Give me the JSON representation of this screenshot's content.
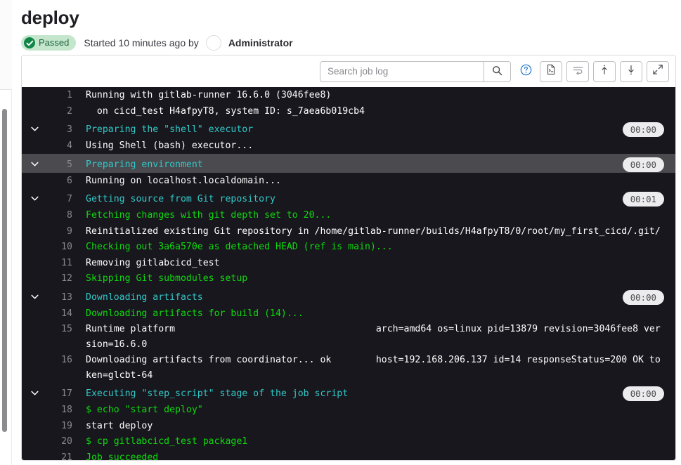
{
  "header": {
    "title": "deploy",
    "status_label": "Passed",
    "status_color": "#108548",
    "status_bg": "#c3e6cd",
    "started_text": "Started 10 minutes ago by",
    "author": "Administrator"
  },
  "toolbar": {
    "search_placeholder": "Search job log",
    "search_value": "",
    "search_button_label": "search-icon",
    "help_label": "help-icon",
    "raw_label": "show-raw-icon",
    "wrap_label": "toggle-soft-wrap-icon",
    "scroll_top_label": "scroll-to-top-icon",
    "scroll_bottom_label": "scroll-to-bottom-icon",
    "fullscreen_label": "fullscreen-icon"
  },
  "log": {
    "lines": [
      {
        "n": "1",
        "text": "Running with gitlab-runner 16.6.0 (3046fee8)",
        "color": "white",
        "section": false,
        "collapsible": false,
        "duration": "",
        "highlight": false
      },
      {
        "n": "2",
        "text": "  on cicd_test H4afpyT8, system ID: s_7aea6b019cb4",
        "color": "white",
        "section": false,
        "collapsible": false,
        "duration": "",
        "highlight": false
      },
      {
        "n": "3",
        "text": "Preparing the \"shell\" executor",
        "color": "cyan",
        "section": true,
        "collapsible": true,
        "duration": "00:00",
        "highlight": false
      },
      {
        "n": "4",
        "text": "Using Shell (bash) executor...",
        "color": "white",
        "section": false,
        "collapsible": false,
        "duration": "",
        "highlight": false
      },
      {
        "n": "5",
        "text": "Preparing environment",
        "color": "cyan",
        "section": true,
        "collapsible": true,
        "duration": "00:00",
        "highlight": true
      },
      {
        "n": "6",
        "text": "Running on localhost.localdomain...",
        "color": "white",
        "section": false,
        "collapsible": false,
        "duration": "",
        "highlight": false
      },
      {
        "n": "7",
        "text": "Getting source from Git repository",
        "color": "cyan",
        "section": true,
        "collapsible": true,
        "duration": "00:01",
        "highlight": false
      },
      {
        "n": "8",
        "text": "Fetching changes with git depth set to 20...",
        "color": "green",
        "section": false,
        "collapsible": false,
        "duration": "",
        "highlight": false
      },
      {
        "n": "9",
        "text": "Reinitialized existing Git repository in /home/gitlab-runner/builds/H4afpyT8/0/root/my_first_cicd/.git/",
        "color": "white",
        "section": false,
        "collapsible": false,
        "duration": "",
        "highlight": false
      },
      {
        "n": "10",
        "text": "Checking out 3a6a570e as detached HEAD (ref is main)...",
        "color": "green",
        "section": false,
        "collapsible": false,
        "duration": "",
        "highlight": false
      },
      {
        "n": "11",
        "text": "Removing gitlabcicd_test",
        "color": "white",
        "section": false,
        "collapsible": false,
        "duration": "",
        "highlight": false
      },
      {
        "n": "12",
        "text": "Skipping Git submodules setup",
        "color": "green",
        "section": false,
        "collapsible": false,
        "duration": "",
        "highlight": false
      },
      {
        "n": "13",
        "text": "Downloading artifacts",
        "color": "cyan",
        "section": true,
        "collapsible": true,
        "duration": "00:00",
        "highlight": false
      },
      {
        "n": "14",
        "text": "Downloading artifacts for build (14)...",
        "color": "green",
        "section": false,
        "collapsible": false,
        "duration": "",
        "highlight": false
      },
      {
        "n": "15",
        "text": "Runtime platform                                    arch=amd64 os=linux pid=13879 revision=3046fee8 version=16.6.0",
        "color": "white",
        "section": false,
        "collapsible": false,
        "duration": "",
        "highlight": false
      },
      {
        "n": "16",
        "text": "Downloading artifacts from coordinator... ok        host=192.168.206.137 id=14 responseStatus=200 OK token=glcbt-64",
        "color": "white",
        "section": false,
        "collapsible": false,
        "duration": "",
        "highlight": false
      },
      {
        "n": "17",
        "text": "Executing \"step_script\" stage of the job script",
        "color": "cyan",
        "section": true,
        "collapsible": true,
        "duration": "00:00",
        "highlight": false
      },
      {
        "n": "18",
        "text": "$ echo \"start deploy\"",
        "color": "green",
        "section": false,
        "collapsible": false,
        "duration": "",
        "highlight": false
      },
      {
        "n": "19",
        "text": "start deploy",
        "color": "white",
        "section": false,
        "collapsible": false,
        "duration": "",
        "highlight": false
      },
      {
        "n": "20",
        "text": "$ cp gitlabcicd_test package1",
        "color": "green",
        "section": false,
        "collapsible": false,
        "duration": "",
        "highlight": false
      },
      {
        "n": "21",
        "text": "Job succeeded",
        "color": "green",
        "section": false,
        "collapsible": false,
        "duration": "",
        "highlight": false
      }
    ]
  }
}
